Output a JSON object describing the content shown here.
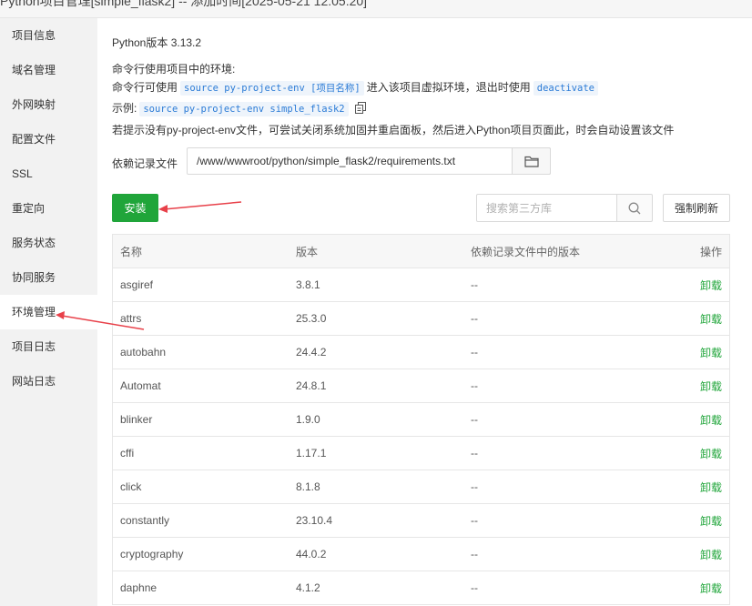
{
  "title": "Python项目管理[simple_flask2] -- 添加时间[2025-05-21 12:05:20]",
  "sidebar": {
    "items": [
      {
        "label": "项目信息"
      },
      {
        "label": "域名管理"
      },
      {
        "label": "外网映射"
      },
      {
        "label": "配置文件"
      },
      {
        "label": "SSL"
      },
      {
        "label": "重定向"
      },
      {
        "label": "服务状态"
      },
      {
        "label": "协同服务"
      },
      {
        "label": "环境管理",
        "active": true
      },
      {
        "label": "项目日志"
      },
      {
        "label": "网站日志"
      }
    ]
  },
  "info": {
    "python_version": "Python版本 3.13.2",
    "env_heading": "命令行使用项目中的环境:",
    "cmd_prefix": "命令行可使用",
    "cmd_code": "source py-project-env [项目名称]",
    "cmd_middle": "进入该项目虚拟环境，退出时使用",
    "cmd_deactivate": "deactivate",
    "example_label": "示例:",
    "example_code": "source py-project-env simple_flask2",
    "notice": "若提示没有py-project-env文件，可尝试关闭系统加固并重启面板，然后进入Python项目页面此，时会自动设置该文件"
  },
  "deps": {
    "label": "依赖记录文件",
    "path": "/www/wwwroot/python/simple_flask2/requirements.txt"
  },
  "toolbar": {
    "install_label": "安装",
    "search_placeholder": "搜索第三方库",
    "refresh_label": "强制刷新"
  },
  "table": {
    "headers": [
      "名称",
      "版本",
      "依赖记录文件中的版本",
      "操作"
    ],
    "rows": [
      {
        "name": "asgiref",
        "version": "3.8.1",
        "req_version": "--",
        "action": "卸载"
      },
      {
        "name": "attrs",
        "version": "25.3.0",
        "req_version": "--",
        "action": "卸载"
      },
      {
        "name": "autobahn",
        "version": "24.4.2",
        "req_version": "--",
        "action": "卸载"
      },
      {
        "name": "Automat",
        "version": "24.8.1",
        "req_version": "--",
        "action": "卸载"
      },
      {
        "name": "blinker",
        "version": "1.9.0",
        "req_version": "--",
        "action": "卸载"
      },
      {
        "name": "cffi",
        "version": "1.17.1",
        "req_version": "--",
        "action": "卸载"
      },
      {
        "name": "click",
        "version": "8.1.8",
        "req_version": "--",
        "action": "卸载"
      },
      {
        "name": "constantly",
        "version": "23.10.4",
        "req_version": "--",
        "action": "卸载"
      },
      {
        "name": "cryptography",
        "version": "44.0.2",
        "req_version": "--",
        "action": "卸载"
      },
      {
        "name": "daphne",
        "version": "4.1.2",
        "req_version": "--",
        "action": "卸载"
      }
    ]
  },
  "colors": {
    "accent_green": "#20a53a",
    "annotation_red": "#e8414a",
    "code_blue": "#2b7bd6"
  }
}
